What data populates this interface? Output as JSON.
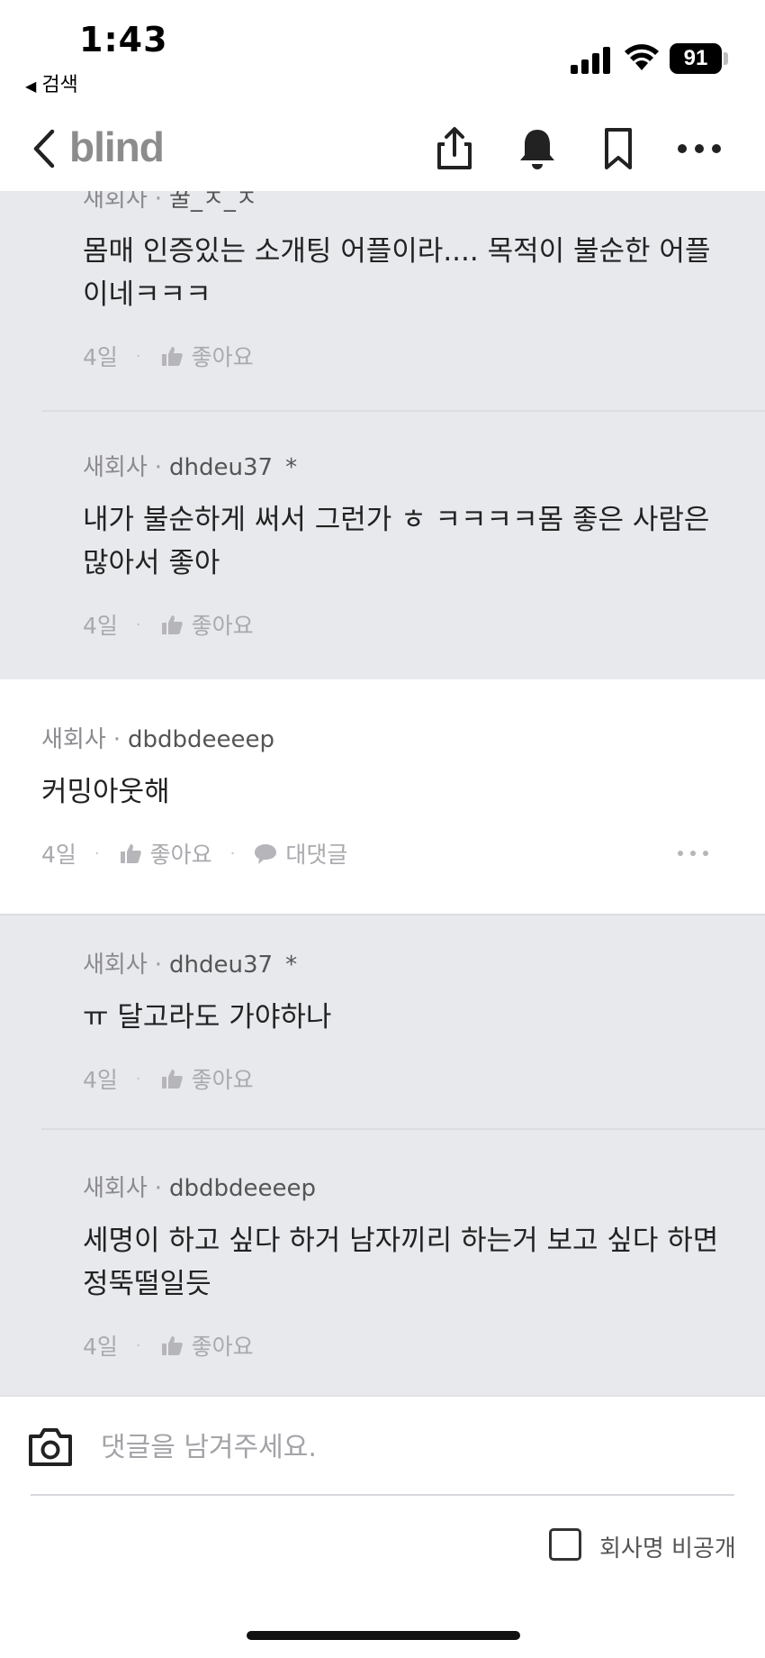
{
  "status_bar": {
    "time": "1:43",
    "back_app": "검색",
    "battery": "91"
  },
  "header": {
    "logo": "blind"
  },
  "comments": [
    {
      "company": "새회사",
      "user": "꿀_ㅈ_ㅈ",
      "body": "몸매 인증있는 소개팅 어플이라.... 목적이 불순한 어플이네ㅋㅋㅋ",
      "time": "4일",
      "like": "좋아요"
    },
    {
      "company": "새회사",
      "user": "dhdeu37",
      "op_mark": "*",
      "body": "내가 불순하게 써서 그런가 ㅎ ㅋㅋㅋㅋ몸 좋은 사람은 많아서 좋아",
      "time": "4일",
      "like": "좋아요"
    },
    {
      "company": "새회사",
      "user": "dbdbdeeeep",
      "body": "커밍아웃해",
      "time": "4일",
      "like": "좋아요",
      "reply": "대댓글"
    },
    {
      "company": "새회사",
      "user": "dhdeu37",
      "op_mark": "*",
      "body": "ㅠ 달고라도 가야하나",
      "time": "4일",
      "like": "좋아요"
    },
    {
      "company": "새회사",
      "user": "dbdbdeeeep",
      "body": "세명이 하고 싶다 하거 남자끼리 하는거 보고 싶다 하면 정뚝떨일듯",
      "time": "4일",
      "like": "좋아요"
    }
  ],
  "composer": {
    "placeholder": "댓글을 남겨주세요.",
    "hide_company_label": "회사명 비공개"
  }
}
